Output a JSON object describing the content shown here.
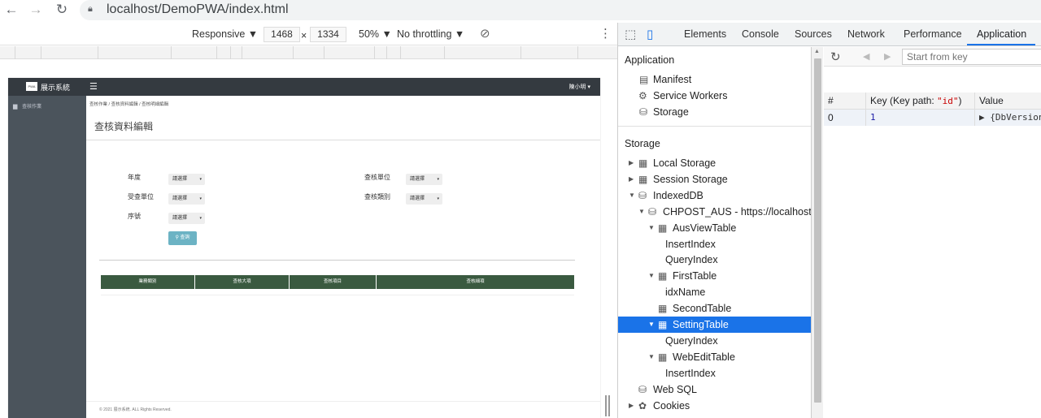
{
  "browser": {
    "url": "localhost/DemoPWA/index.html"
  },
  "device_toolbar": {
    "mode": "Responsive ▼",
    "width": "1468",
    "times": "×",
    "height": "1334",
    "zoom": "50% ▼",
    "throttling": "No throttling ▼"
  },
  "pwa": {
    "logo": "PWA",
    "app_title": "展示系統",
    "user": "陳小明 ▾",
    "sidebar_item": "查核作業",
    "breadcrumb": "查核作業 / 查核資料編輯 / 查核明細編輯",
    "page_title": "查核資料編輯",
    "fields": [
      {
        "label": "年度",
        "select": "請選擇"
      },
      {
        "label": "受查單位",
        "select": "請選擇"
      },
      {
        "label": "序號",
        "select": "請選擇"
      },
      {
        "label": "查核單位",
        "select": "請選擇"
      },
      {
        "label": "查核類別",
        "select": "請選擇"
      }
    ],
    "search_button": "查詢",
    "table_headers": [
      "業務類別",
      "查核大項",
      "查核項目",
      "查核細項"
    ],
    "footer": "© 2021 展示系統. ALL Rights Reserved."
  },
  "devtools": {
    "tabs": [
      "Elements",
      "Console",
      "Sources",
      "Network",
      "Performance",
      "Application"
    ],
    "active_tab": "Application",
    "sidebar": {
      "application_title": "Application",
      "application_items": [
        "Manifest",
        "Service Workers",
        "Storage"
      ],
      "storage_title": "Storage",
      "tree": [
        {
          "label": "Local Storage",
          "depth": 0,
          "arrow": "▶",
          "icon": "grid"
        },
        {
          "label": "Session Storage",
          "depth": 0,
          "arrow": "▶",
          "icon": "grid"
        },
        {
          "label": "IndexedDB",
          "depth": 0,
          "arrow": "▼",
          "icon": "db"
        },
        {
          "label": "CHPOST_AUS - https://localhost",
          "depth": 1,
          "arrow": "▼",
          "icon": "db"
        },
        {
          "label": "AusViewTable",
          "depth": 2,
          "arrow": "▼",
          "icon": "grid"
        },
        {
          "label": "InsertIndex",
          "depth": 3,
          "arrow": "",
          "icon": ""
        },
        {
          "label": "QueryIndex",
          "depth": 3,
          "arrow": "",
          "icon": ""
        },
        {
          "label": "FirstTable",
          "depth": 2,
          "arrow": "▼",
          "icon": "grid"
        },
        {
          "label": "idxName",
          "depth": 3,
          "arrow": "",
          "icon": ""
        },
        {
          "label": "SecondTable",
          "depth": 2,
          "arrow": "",
          "icon": "grid"
        },
        {
          "label": "SettingTable",
          "depth": 2,
          "arrow": "▼",
          "icon": "grid",
          "selected": true
        },
        {
          "label": "QueryIndex",
          "depth": 3,
          "arrow": "",
          "icon": ""
        },
        {
          "label": "WebEditTable",
          "depth": 2,
          "arrow": "▼",
          "icon": "grid"
        },
        {
          "label": "InsertIndex",
          "depth": 3,
          "arrow": "",
          "icon": ""
        },
        {
          "label": "Web SQL",
          "depth": 0,
          "arrow": "",
          "icon": "db"
        },
        {
          "label": "Cookies",
          "depth": 0,
          "arrow": "▶",
          "icon": "cookie"
        }
      ]
    },
    "data_panel": {
      "key_placeholder": "Start from key",
      "col_index": "#",
      "col_key_prefix": "Key (Key path: ",
      "col_key_path": "\"id\"",
      "col_key_suffix": ")",
      "col_value": "Value",
      "row_index": "0",
      "row_key": "1",
      "row_value": "▶ {DbVersion"
    }
  }
}
